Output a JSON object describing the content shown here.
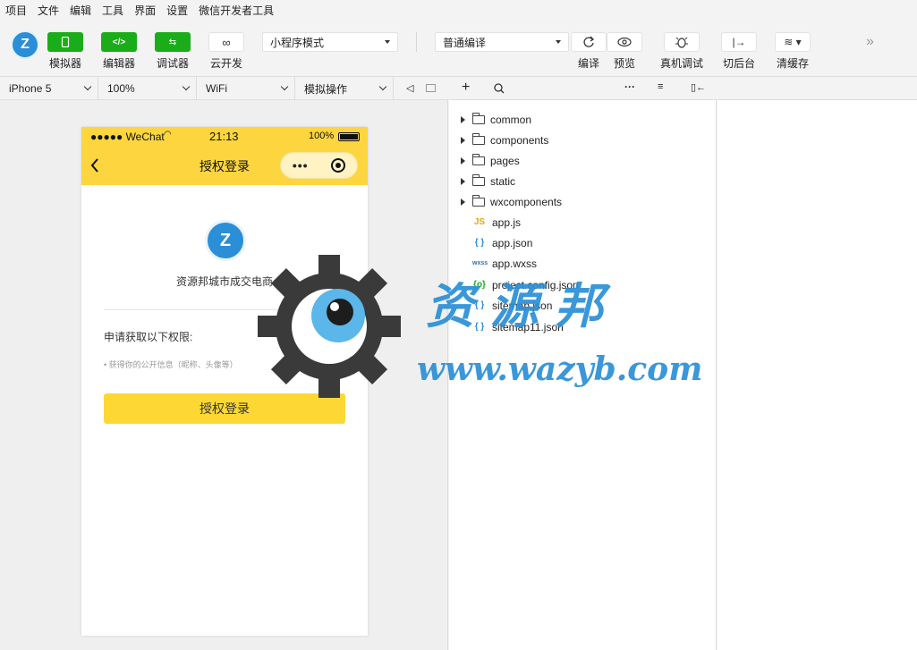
{
  "menu": [
    "项目",
    "文件",
    "编辑",
    "工具",
    "界面",
    "设置",
    "微信开发者工具"
  ],
  "toolbar": {
    "simulator_label": "模拟器",
    "editor_label": "编辑器",
    "debugger_label": "调试器",
    "cloud_label": "云开发",
    "mode_select": "小程序模式",
    "compile_select": "普通编译",
    "compile_label": "编译",
    "preview_label": "预览",
    "realdebug_label": "真机调试",
    "background_label": "切后台",
    "clearcache_label": "清缓存"
  },
  "simbar": {
    "device": "iPhone 5",
    "zoom": "100%",
    "network": "WiFi",
    "operation": "模拟操作"
  },
  "phone": {
    "status_left": "●●●●● WeChat",
    "status_time": "21:13",
    "status_battery": "100%",
    "nav_title": "授权登录",
    "app_name": "资源邦城市成交电商",
    "perm_title": "申请获取以下权限:",
    "perm_detail": "• 获得你的公开信息（昵称、头像等）",
    "auth_button": "授权登录"
  },
  "files": [
    {
      "name": "common",
      "type": "folder"
    },
    {
      "name": "components",
      "type": "folder"
    },
    {
      "name": "pages",
      "type": "folder"
    },
    {
      "name": "static",
      "type": "folder"
    },
    {
      "name": "wxcomponents",
      "type": "folder"
    },
    {
      "name": "app.js",
      "type": "js",
      "badge": "JS"
    },
    {
      "name": "app.json",
      "type": "json",
      "badge": "{ }"
    },
    {
      "name": "app.wxss",
      "type": "wxss",
      "badge": "wxss"
    },
    {
      "name": "project.config.json",
      "type": "config",
      "badge": "{o}"
    },
    {
      "name": "sitemap.json",
      "type": "json",
      "badge": "{ }"
    },
    {
      "name": "sitemap11.json",
      "type": "json",
      "badge": "{ }"
    }
  ],
  "watermark": {
    "text": "资源邦",
    "url": "www.wazyb.com"
  },
  "colors": {
    "accent_green": "#1aad19",
    "brand_yellow": "#fcd53f",
    "watermark_blue": "#2a8fd6"
  }
}
